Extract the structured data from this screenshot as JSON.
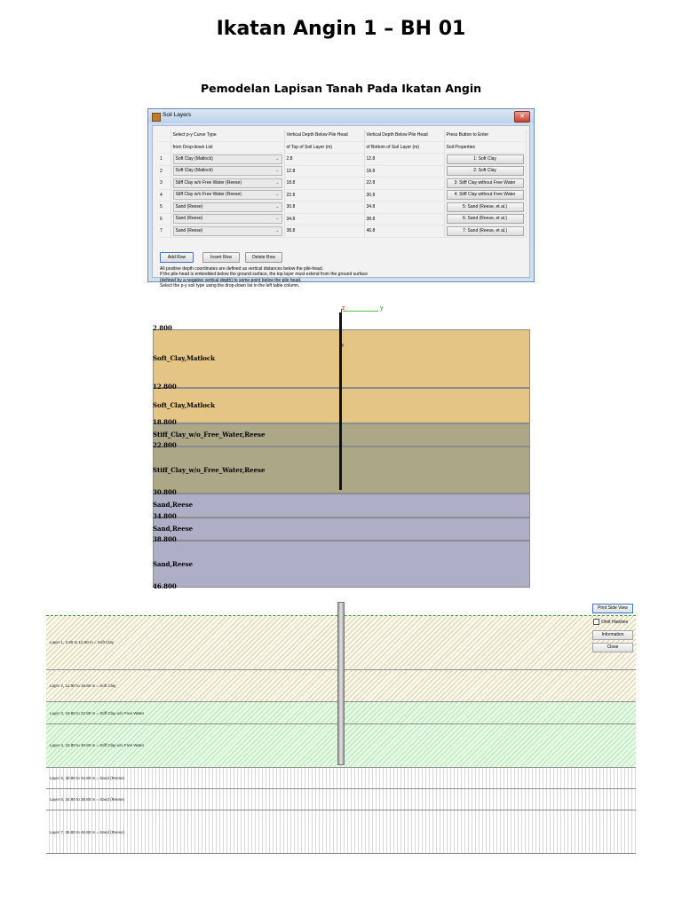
{
  "page": {
    "title": "Ikatan Angin 1 – BH 01",
    "subtitle": "Pemodelan Lapisan Tanah Pada Ikatan Angin"
  },
  "dialog": {
    "title": "Soil Layers",
    "close_glyph": "✕",
    "headers_row1": [
      "",
      "Select p-y Curve Type",
      "Vertical Depth Below Pile Head",
      "Vertical Depth Below Pile Head",
      "Press Button to Enter"
    ],
    "headers_row2": [
      "",
      "from Drop-down List",
      "of Top of Soil Layer (m)",
      "of Bottom of Soil Layer (m)",
      "Soil Properties"
    ],
    "rows": [
      {
        "num": "1",
        "type": "Soft Clay (Matlock)",
        "top": "2.8",
        "bottom": "12.8",
        "button": "1: Soft Clay"
      },
      {
        "num": "2",
        "type": "Soft Clay (Matlock)",
        "top": "12.8",
        "bottom": "18.8",
        "button": "2: Soft Clay"
      },
      {
        "num": "3",
        "type": "Stiff Clay w/o Free Water (Reese)",
        "top": "18.8",
        "bottom": "22.8",
        "button": "3: Stiff Clay without Free Water"
      },
      {
        "num": "4",
        "type": "Stiff Clay w/o Free Water (Reese)",
        "top": "22.8",
        "bottom": "30.8",
        "button": "4: Stiff Clay without Free Water"
      },
      {
        "num": "5",
        "type": "Sand (Reese)",
        "top": "30.8",
        "bottom": "34.8",
        "button": "5: Sand (Reese, et al.)"
      },
      {
        "num": "6",
        "type": "Sand (Reese)",
        "top": "34.8",
        "bottom": "38.8",
        "button": "6: Sand (Reese, et al.)"
      },
      {
        "num": "7",
        "type": "Sand (Reese)",
        "top": "38.8",
        "bottom": "46.8",
        "button": "7: Sand (Reese, et al.)"
      }
    ],
    "buttons": {
      "add": "Add Row",
      "insert": "Insert Row",
      "delete": "Delete Row"
    },
    "notes": [
      "All positive depth coordinates are defined as vertical distances below the pile-head.",
      "If the pile-head is embedded below the ground surface, the top layer must extend from the ground surface",
      "(defined by a negative vertical depth) to some point below the pile head.",
      "Select the p-y soil type using the drop-down list in the left table column."
    ]
  },
  "profile": {
    "axis": {
      "z": "z",
      "y": "y",
      "x": "x"
    },
    "depths": [
      "2.800",
      "12.800",
      "18.800",
      "22.800",
      "30.800",
      "34.800",
      "38.800",
      "46.800"
    ],
    "layers": [
      {
        "name": "Soft_Clay,Matlock",
        "color": "#e5c585"
      },
      {
        "name": "Soft_Clay,Matlock",
        "color": "#e5c585"
      },
      {
        "name": "Stiff_Clay_w/o_Free_Water,Reese",
        "color": "#aca786"
      },
      {
        "name": "Stiff_Clay_w/o_Free_Water,Reese",
        "color": "#aca786"
      },
      {
        "name": "Sand,Reese",
        "color": "#aeaec6"
      },
      {
        "name": "Sand,Reese",
        "color": "#aeaec6"
      },
      {
        "name": "Sand,Reese",
        "color": "#aeaec6"
      }
    ]
  },
  "side_view": {
    "buttons": {
      "print": "Print Side View",
      "info": "Information",
      "close": "Close"
    },
    "checkbox": "Omit Hatches",
    "layers": [
      "Layer 1, 2.80 to 12.80 m = Soft Clay",
      "Layer 2, 12.80 to 18.80 m = Soft Clay",
      "Layer 3, 18.80 to 22.80 m = Stiff Clay w/o Free Water",
      "Layer 4, 22.80 to 30.80 m = Stiff Clay w/o Free Water",
      "Layer 5, 30.80 to 34.80 m = Sand (Reese)",
      "Layer 6, 34.80 to 38.80 m = Sand (Reese)",
      "Layer 7, 38.80 to 46.80 m = Sand (Reese)"
    ]
  }
}
